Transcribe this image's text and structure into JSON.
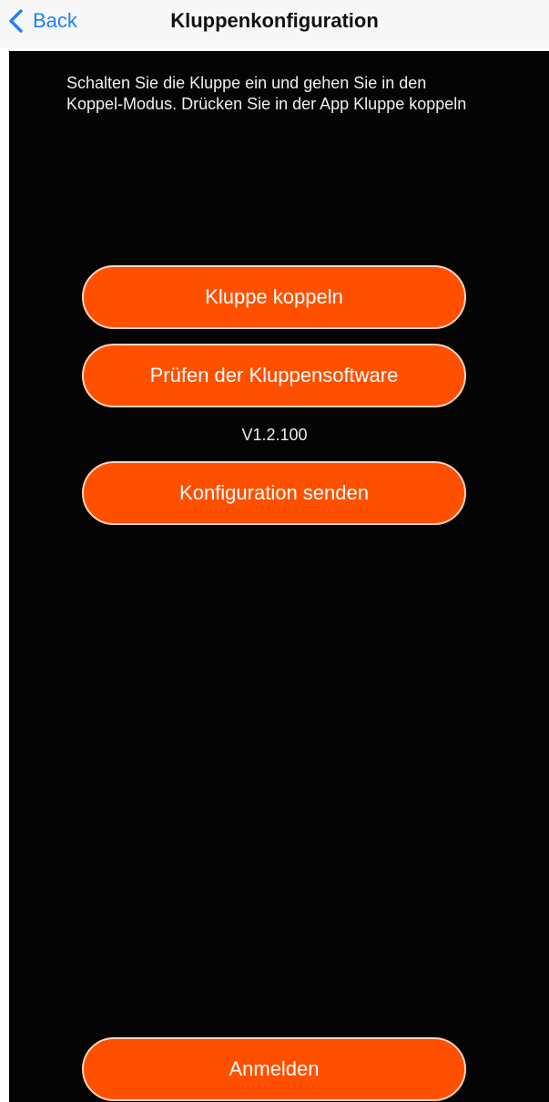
{
  "navbar": {
    "back_label": "Back",
    "title": "Kluppenkonfiguration",
    "accent_color": "#1a82f7"
  },
  "main": {
    "instructions": "Schalten Sie die Kluppe ein und gehen Sie in den Koppel-Modus. Drücken Sie in der App Kluppe koppeln",
    "buttons": {
      "pair_label": "Kluppe koppeln",
      "check_software_label": "Prüfen der Kluppensoftware",
      "send_config_label": "Konfiguration senden",
      "login_label": "Anmelden"
    },
    "version": "V1.2.100",
    "button_color": "#ff5000",
    "background_color": "#040404"
  }
}
